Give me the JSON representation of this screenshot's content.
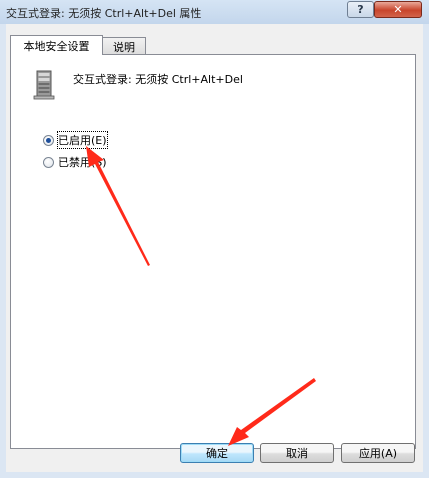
{
  "window": {
    "title": "交互式登录: 无须按 Ctrl+Alt+Del 属性",
    "help_label": "?",
    "close_label": "✕"
  },
  "tabs": [
    {
      "label": "本地安全设置"
    },
    {
      "label": "说明"
    }
  ],
  "policy": {
    "icon": "server-tower-icon",
    "name": "交互式登录: 无须按 Ctrl+Alt+Del"
  },
  "options": [
    {
      "label": "已启用(E)",
      "selected": true
    },
    {
      "label": "已禁用(S)",
      "selected": false
    }
  ],
  "buttons": {
    "ok": "确定",
    "cancel": "取消",
    "apply": "应用(A)"
  },
  "colors": {
    "annotation_arrow": "#ff2a1a"
  }
}
